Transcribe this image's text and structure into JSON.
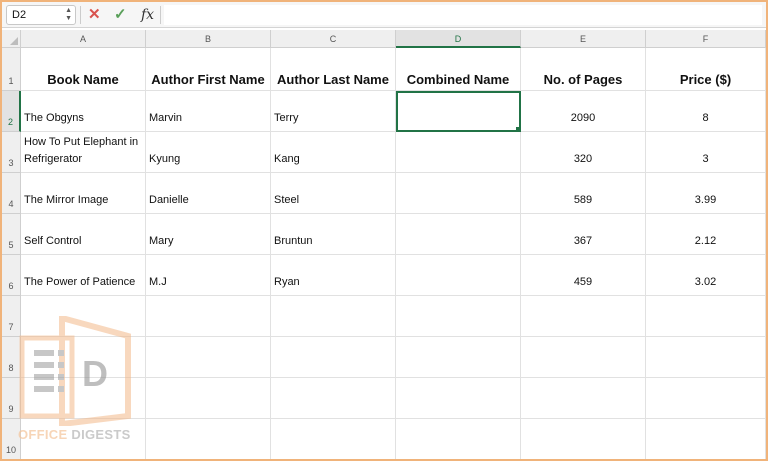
{
  "formula_bar": {
    "name_box": "D2",
    "cancel_icon": "cancel-icon",
    "enter_icon": "enter-icon",
    "fx_label": "fx",
    "formula_value": ""
  },
  "columns": [
    "A",
    "B",
    "C",
    "D",
    "E",
    "F"
  ],
  "active_column": "D",
  "rows": [
    "1",
    "2",
    "3",
    "4",
    "5",
    "6",
    "7",
    "8",
    "9",
    "10"
  ],
  "active_row": "2",
  "headers": [
    "Book Name",
    "Author First Name",
    "Author Last Name",
    "Combined Name",
    "No. of Pages",
    "Price ($)"
  ],
  "data": [
    [
      "The Obgyns",
      "Marvin",
      "Terry",
      "",
      "2090",
      "8"
    ],
    [
      "How To Put Elephant in Refrigerator",
      "Kyung",
      "Kang",
      "",
      "320",
      "3"
    ],
    [
      "The Mirror Image",
      "Danielle",
      "Steel",
      "",
      "589",
      "3.99"
    ],
    [
      "Self Control",
      "Mary",
      "Bruntun",
      "",
      "367",
      "2.12"
    ],
    [
      "The Power of Patience",
      "M.J",
      "Ryan",
      "",
      "459",
      "3.02"
    ]
  ],
  "watermark": {
    "logo_letter": "D",
    "brand_first": "OFFICE",
    "brand_second": "DIGESTS"
  },
  "colors": {
    "selection": "#217346",
    "frame_border": "#f0b37a",
    "cancel": "#d9534f",
    "enter": "#5aa05a"
  }
}
